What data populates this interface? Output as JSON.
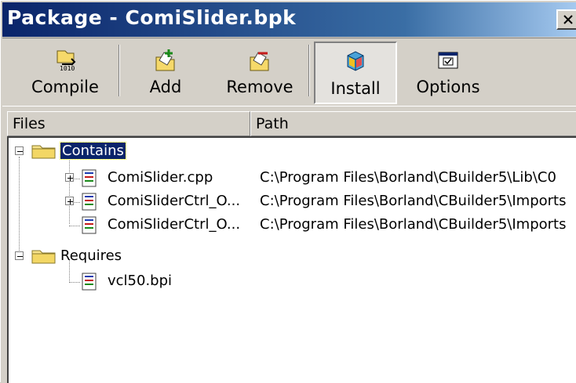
{
  "window": {
    "title": "Package - ComiSlider.bpk",
    "close_label": "×"
  },
  "toolbar": {
    "buttons": [
      {
        "id": "compile",
        "label": "Compile",
        "icon": "compile-icon"
      },
      {
        "id": "add",
        "label": "Add",
        "icon": "add-icon"
      },
      {
        "id": "remove",
        "label": "Remove",
        "icon": "remove-icon"
      },
      {
        "id": "install",
        "label": "Install",
        "icon": "install-icon",
        "pressed": true
      },
      {
        "id": "options",
        "label": "Options",
        "icon": "options-icon"
      }
    ]
  },
  "list": {
    "columns": [
      "Files",
      "Path"
    ],
    "rows": [
      {
        "name": "Contains",
        "path": "",
        "type": "folder",
        "selected": true
      },
      {
        "name": "ComiSlider.cpp",
        "path": "C:\\Program Files\\Borland\\CBuilder5\\Lib\\C0",
        "type": "file"
      },
      {
        "name": "ComiSliderCtrl_O...",
        "path": "C:\\Program Files\\Borland\\CBuilder5\\Imports",
        "type": "file"
      },
      {
        "name": "ComiSliderCtrl_O...",
        "path": "C:\\Program Files\\Borland\\CBuilder5\\Imports",
        "type": "file"
      },
      {
        "name": "Requires",
        "path": "",
        "type": "folder"
      },
      {
        "name": "vcl50.bpi",
        "path": "",
        "type": "file"
      }
    ]
  },
  "colors": {
    "title_start": "#0a246a",
    "title_end": "#a6caf0",
    "selection": "#0a246a",
    "face": "#d4d0c8"
  }
}
